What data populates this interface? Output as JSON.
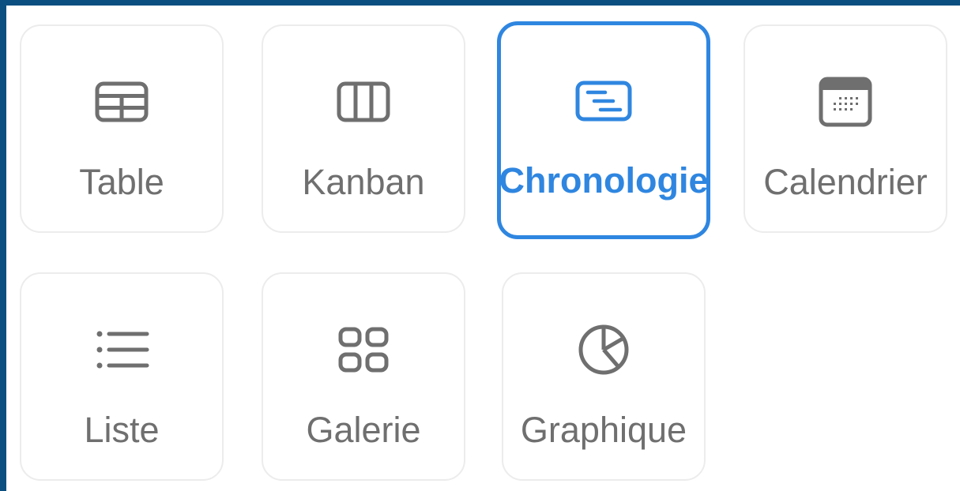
{
  "colors": {
    "frame_border": "#0b4f80",
    "card_border": "#ececec",
    "icon_gray": "#6f6f6f",
    "selected_blue": "#2f86e0"
  },
  "views": [
    {
      "id": "table",
      "label": "Table",
      "icon": "table-icon",
      "selected": false
    },
    {
      "id": "kanban",
      "label": "Kanban",
      "icon": "kanban-icon",
      "selected": false
    },
    {
      "id": "chronologie",
      "label": "Chronologie",
      "icon": "timeline-icon",
      "selected": true
    },
    {
      "id": "calendrier",
      "label": "Calendrier",
      "icon": "calendar-icon",
      "selected": false
    },
    {
      "id": "liste",
      "label": "Liste",
      "icon": "list-icon",
      "selected": false
    },
    {
      "id": "galerie",
      "label": "Galerie",
      "icon": "gallery-icon",
      "selected": false
    },
    {
      "id": "graphique",
      "label": "Graphique",
      "icon": "chart-icon",
      "selected": false
    }
  ]
}
